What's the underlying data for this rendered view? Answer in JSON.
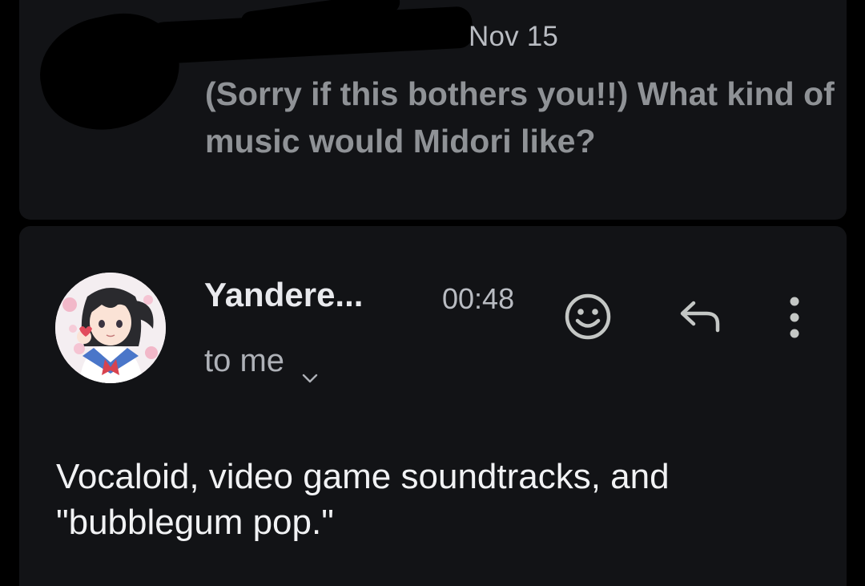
{
  "previous_message": {
    "date": "Nov 15",
    "snippet": "(Sorry if this bothers you!!) What kind of music would Midori like?"
  },
  "open_message": {
    "sender": "Yandere...",
    "time": "00:48",
    "recipient": "to me",
    "body": "Vocaloid, video game soundtracks, and \"bubblegum pop.\""
  },
  "icons": {
    "avatar": "avatar-anime-character",
    "react": "smiley-icon",
    "reply": "reply-arrow-icon",
    "more": "more-vert-icon",
    "recipient_expand": "chevron-down-icon"
  },
  "colors": {
    "background": "#000000",
    "card": "#121316",
    "primary_text": "#f1f2f4",
    "secondary_text": "#b9bcc2",
    "icon": "#c4c7c5"
  }
}
